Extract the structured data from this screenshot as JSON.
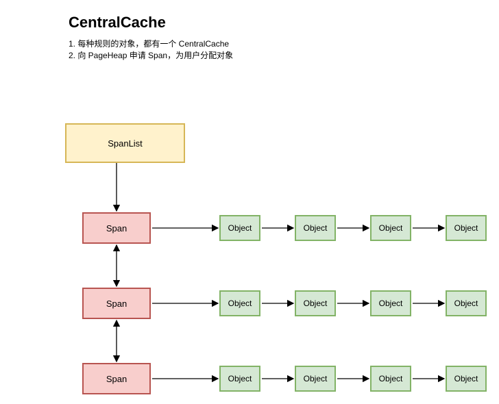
{
  "title": "CentralCache",
  "description": {
    "line1": "1. 每种规则的对象，都有一个 CentralCache",
    "line2": "2. 向 PageHeap 申请 Span，为用户分配对象"
  },
  "nodes": {
    "spanlist": "SpanList",
    "span": "Span",
    "object": "Object"
  }
}
